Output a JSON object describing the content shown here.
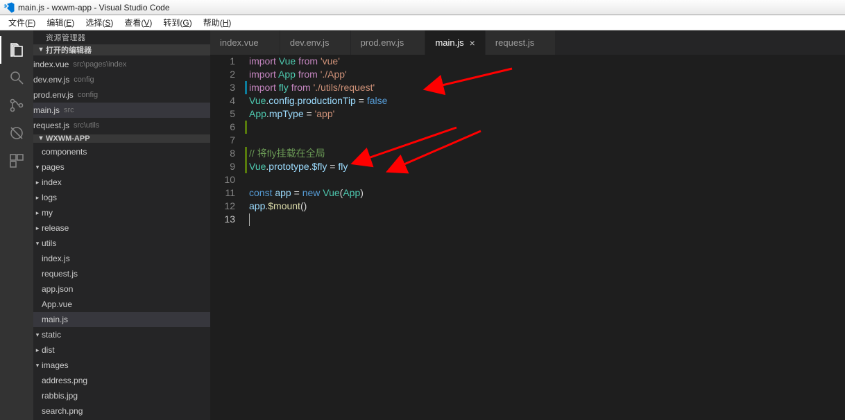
{
  "window": {
    "title": "main.js - wxwm-app - Visual Studio Code"
  },
  "menubar": [
    {
      "label": "文件",
      "key": "F"
    },
    {
      "label": "编辑",
      "key": "E"
    },
    {
      "label": "选择",
      "key": "S"
    },
    {
      "label": "查看",
      "key": "V"
    },
    {
      "label": "转到",
      "key": "G"
    },
    {
      "label": "帮助",
      "key": "H"
    }
  ],
  "sidebar": {
    "title": "资源管理器",
    "openEditorsHdr": "打开的编辑器",
    "openEditors": [
      {
        "name": "index.vue",
        "meta": "src\\pages\\index"
      },
      {
        "name": "dev.env.js",
        "meta": "config"
      },
      {
        "name": "prod.env.js",
        "meta": "config"
      },
      {
        "name": "main.js",
        "meta": "src",
        "active": true
      },
      {
        "name": "request.js",
        "meta": "src\\utils"
      }
    ],
    "projectHdr": "WXWM-APP",
    "tree": [
      {
        "d": 2,
        "tw": "",
        "name": "components"
      },
      {
        "d": 2,
        "tw": "▾",
        "name": "pages"
      },
      {
        "d": 3,
        "tw": "▸",
        "name": "index"
      },
      {
        "d": 3,
        "tw": "▸",
        "name": "logs"
      },
      {
        "d": 3,
        "tw": "▸",
        "name": "my"
      },
      {
        "d": 3,
        "tw": "▸",
        "name": "release"
      },
      {
        "d": 2,
        "tw": "▾",
        "name": "utils"
      },
      {
        "d": 3,
        "tw": "",
        "name": "index.js"
      },
      {
        "d": 3,
        "tw": "",
        "name": "request.js"
      },
      {
        "d": 2,
        "tw": "",
        "name": "app.json"
      },
      {
        "d": 2,
        "tw": "",
        "name": "App.vue"
      },
      {
        "d": 2,
        "tw": "",
        "name": "main.js",
        "active": true
      },
      {
        "d": 1,
        "tw": "▾",
        "name": "static"
      },
      {
        "d": 2,
        "tw": "▸",
        "name": "dist"
      },
      {
        "d": 2,
        "tw": "▾",
        "name": "images"
      },
      {
        "d": 3,
        "tw": "",
        "name": "address.png"
      },
      {
        "d": 3,
        "tw": "",
        "name": "rabbis.jpg"
      },
      {
        "d": 3,
        "tw": "",
        "name": "search.png"
      }
    ]
  },
  "tabs": [
    {
      "label": "index.vue"
    },
    {
      "label": "dev.env.js"
    },
    {
      "label": "prod.env.js"
    },
    {
      "label": "main.js",
      "active": true
    },
    {
      "label": "request.js"
    }
  ],
  "code": {
    "lines": [
      {
        "n": 1,
        "m": "",
        "h": "<span class='tk-kw'>import</span> <span class='tk-var'>Vue</span> <span class='tk-kw'>from</span> <span class='tk-str'>'vue'</span>"
      },
      {
        "n": 2,
        "m": "",
        "h": "<span class='tk-kw'>import</span> <span class='tk-var'>App</span> <span class='tk-kw'>from</span> <span class='tk-str'>'./App'</span>"
      },
      {
        "n": 3,
        "m": "mod",
        "h": "<span class='tk-kw'>import</span> <span class='tk-var'>fly</span> <span class='tk-kw'>from</span> <span class='tk-str'>'./utils/request'</span>"
      },
      {
        "n": 4,
        "m": "",
        "h": "<span class='tk-var'>Vue</span><span class='tk-pn'>.</span><span class='tk-prop'>config</span><span class='tk-pn'>.</span><span class='tk-prop'>productionTip</span> <span class='tk-pn'>=</span> <span class='tk-bool'>false</span>"
      },
      {
        "n": 5,
        "m": "",
        "h": "<span class='tk-var'>App</span><span class='tk-pn'>.</span><span class='tk-prop'>mpType</span> <span class='tk-pn'>=</span> <span class='tk-str'>'app'</span>"
      },
      {
        "n": 6,
        "m": "add",
        "h": ""
      },
      {
        "n": 7,
        "m": "",
        "h": ""
      },
      {
        "n": 8,
        "m": "add",
        "h": "<span class='tk-cmt'>// 将fly挂载在全局</span>"
      },
      {
        "n": 9,
        "m": "add",
        "h": "<span class='tk-var'>Vue</span><span class='tk-pn'>.</span><span class='tk-prop'>prototype</span><span class='tk-pn'>.</span><span class='tk-prop'>$fly</span> <span class='tk-pn'>=</span> <span class='tk-id'>fly</span>"
      },
      {
        "n": 10,
        "m": "",
        "h": ""
      },
      {
        "n": 11,
        "m": "",
        "h": "<span class='tk-new'>const</span> <span class='tk-id'>app</span> <span class='tk-pn'>=</span> <span class='tk-new'>new</span> <span class='tk-var'>Vue</span><span class='tk-pn'>(</span><span class='tk-var'>App</span><span class='tk-pn'>)</span>"
      },
      {
        "n": 12,
        "m": "",
        "h": "<span class='tk-id'>app</span><span class='tk-pn'>.</span><span class='tk-fn'>$mount</span><span class='tk-pn'>()</span>"
      },
      {
        "n": 13,
        "m": "",
        "h": "",
        "cursor": true
      }
    ]
  }
}
